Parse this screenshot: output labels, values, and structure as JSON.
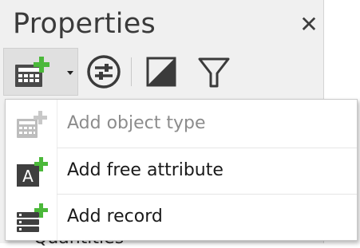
{
  "panel": {
    "title": "Properties",
    "close_icon": "close-icon",
    "behind_text": "Quantities"
  },
  "toolbar": {
    "add_button_icon": "add-object-type-icon",
    "dropdown_icon": "chevron-down-icon",
    "buttons": [
      {
        "icon": "adjust-settings-icon"
      },
      {
        "icon": "contrast-icon"
      },
      {
        "icon": "filter-icon"
      }
    ]
  },
  "menu": {
    "items": [
      {
        "label": "Add object type",
        "icon": "add-object-type-icon",
        "enabled": false
      },
      {
        "label": "Add free attribute",
        "icon": "add-attribute-icon",
        "enabled": true
      },
      {
        "label": "Add record",
        "icon": "add-record-icon",
        "enabled": true
      }
    ]
  },
  "colors": {
    "panel_bg": "#f0f0f0",
    "accent_green": "#4bb83a",
    "menu_bg": "#ffffff",
    "disabled_text": "#8c8c8c"
  }
}
